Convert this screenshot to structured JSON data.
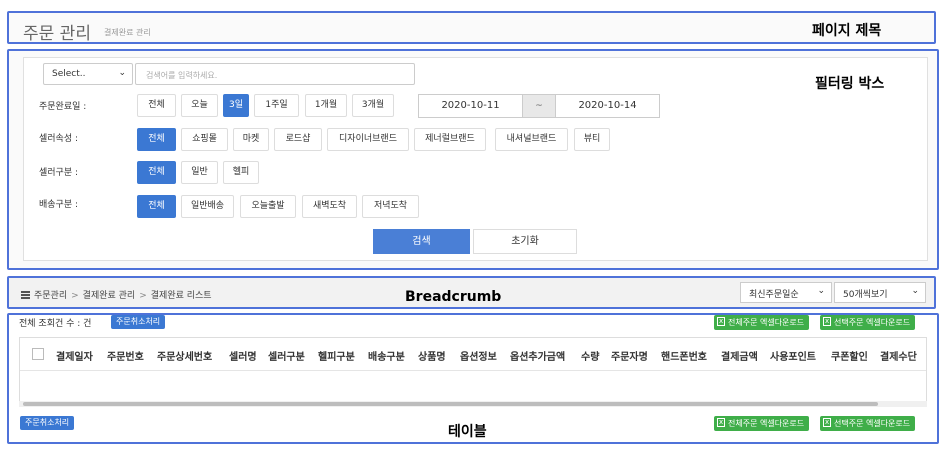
{
  "page_title": {
    "main": "주문 관리",
    "sub": "결제완료 관리"
  },
  "annotations": {
    "title": "페이지 제목",
    "filter": "필터링 박스",
    "breadcrumb": "Breadcrumb",
    "table": "테이블"
  },
  "filter": {
    "select": {
      "value": "Select..",
      "chevron": "⌄"
    },
    "search": {
      "placeholder": "검색어를 입력하세요."
    },
    "order_date": {
      "label": "주문완료일 :",
      "buttons": [
        "전체",
        "오늘",
        "3일",
        "1주일",
        "1개월",
        "3개월"
      ],
      "active": "3일",
      "date_from": "2020-10-11",
      "date_sep": "~",
      "date_to": "2020-10-14"
    },
    "seller_attr": {
      "label": "셀러속성 :",
      "buttons": [
        "전체",
        "쇼핑몰",
        "마켓",
        "로드샵",
        "디자이너브랜드",
        "제너럴브랜드",
        "내셔널브랜드",
        "뷰티"
      ],
      "active": "전체"
    },
    "seller_type": {
      "label": "셀러구분 :",
      "buttons": [
        "전체",
        "일반",
        "헬피"
      ],
      "active": "전체"
    },
    "delivery_type": {
      "label": "배송구분 :",
      "buttons": [
        "전체",
        "일반배송",
        "오늘출발",
        "새벽도착",
        "저녁도착"
      ],
      "active": "전체"
    },
    "search_button": "검색",
    "reset_button": "초기화"
  },
  "breadcrumb": {
    "items": [
      "주문관리",
      "결제완료 관리",
      "결제완료 리스트"
    ],
    "separator": ">",
    "sort_select": "최신주문일순",
    "page_size_select": "50개씩보기",
    "chevron": "⌄"
  },
  "table": {
    "count_text": "전체 조회건 수 : 건",
    "cancel_button": "주문취소처리",
    "download_all": "전체주문 엑셀다운로드",
    "download_selected": "선택주문 엑셀다운로드",
    "columns": [
      "결제일자",
      "주문번호",
      "주문상세번호",
      "셀러명",
      "셀러구분",
      "헬피구분",
      "배송구분",
      "상품명",
      "옵션정보",
      "옵션추가금액",
      "수량",
      "주문자명",
      "핸드폰번호",
      "결제금액",
      "사용포인트",
      "쿠폰할인",
      "결제수단"
    ]
  },
  "colors": {
    "accent": "#3b78d3",
    "green": "#3fae49",
    "outline": "#4f72d9"
  }
}
